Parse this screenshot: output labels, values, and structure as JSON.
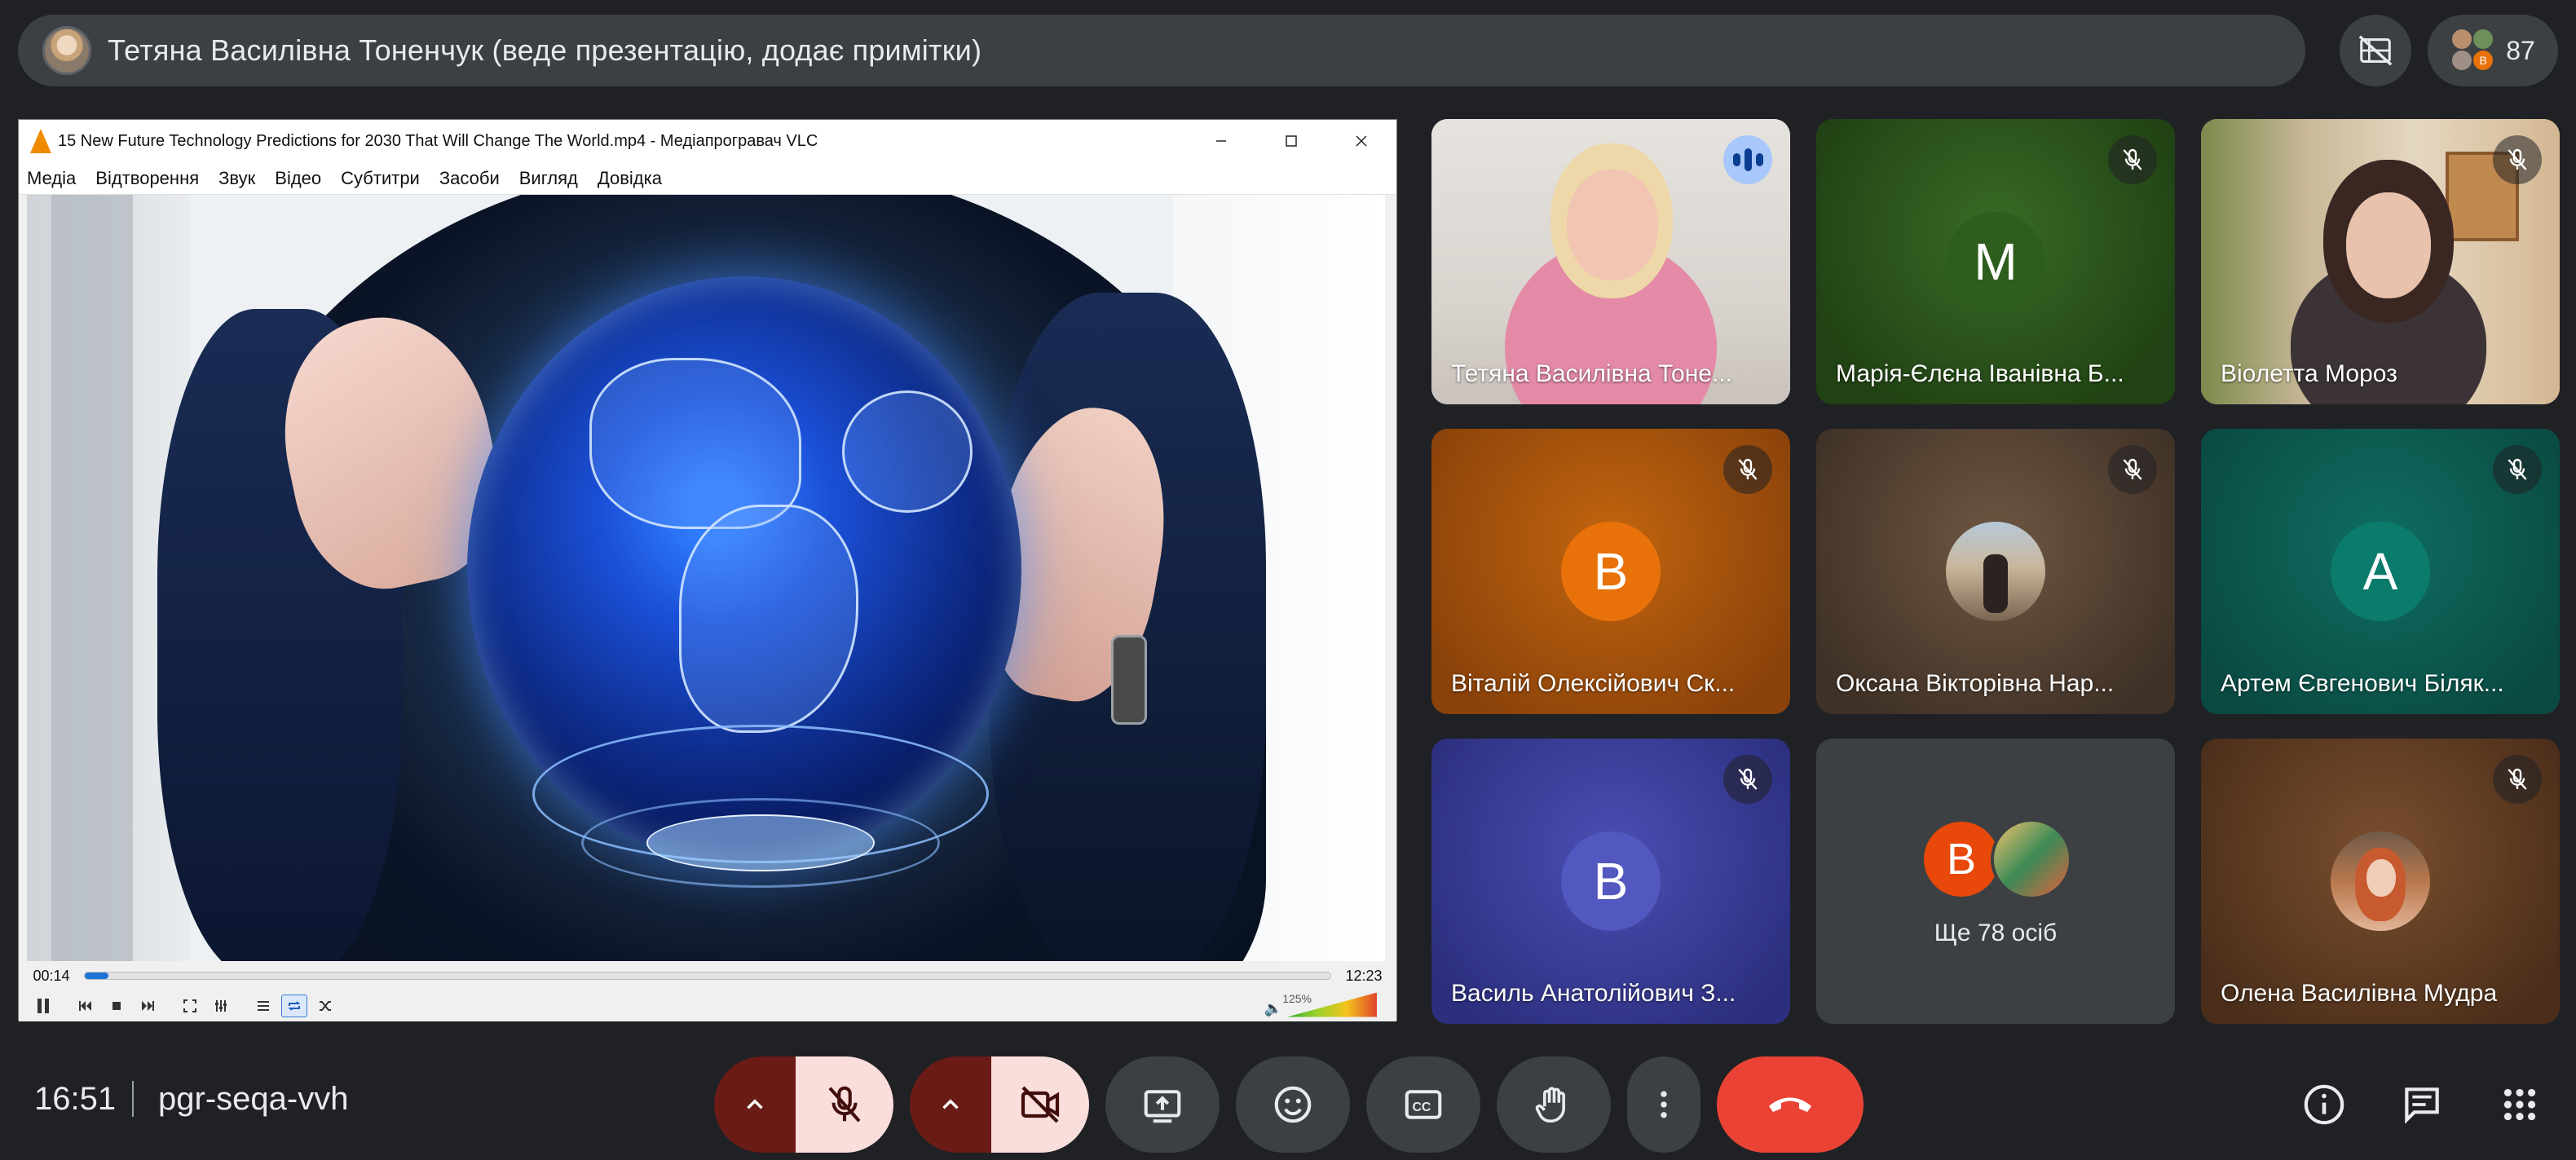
{
  "presenter": {
    "label": "Тетяна Василівна Тоненчук (веде презентацію, додає примітки)"
  },
  "top_right": {
    "participant_count": "87",
    "participant_badge": "В"
  },
  "vlc": {
    "title": "15 New Future Technology Predictions for 2030 That Will Change The World.mp4 - Медіапрогравач VLC",
    "menu": [
      "Медіа",
      "Відтворення",
      "Звук",
      "Відео",
      "Субтитри",
      "Засоби",
      "Вигляд",
      "Довідка"
    ],
    "elapsed": "00:14",
    "total": "12:23",
    "progress_fraction": 0.019,
    "volume": "125%"
  },
  "tiles": [
    {
      "name": "Тетяна Василівна Тоне...",
      "kind": "video",
      "speaking": true
    },
    {
      "name": "Марія-Єлєна Іванівна Б...",
      "kind": "letter",
      "letter": "М",
      "avatar_color": "#2e5e1e",
      "bg": "#23461a",
      "muted": true
    },
    {
      "name": "Віолетта Мороз",
      "kind": "video",
      "muted": true
    },
    {
      "name": "Віталій Олексійович Ск...",
      "kind": "letter",
      "letter": "В",
      "avatar_color": "#e8710a",
      "bg": "#b45309",
      "muted": true
    },
    {
      "name": "Оксана Вікторівна Нар...",
      "kind": "photo",
      "muted": true
    },
    {
      "name": "Артем Євгенович Біляк...",
      "kind": "letter",
      "letter": "А",
      "avatar_color": "#0b7b6b",
      "bg": "#0d5c52",
      "muted": true
    },
    {
      "name": "Василь Анатолійович З...",
      "kind": "letter",
      "letter": "В",
      "avatar_color": "#4b55b5",
      "bg": "#3b3f9c",
      "muted": true
    },
    {
      "name": "",
      "kind": "more",
      "more_label": "Ще 78 осіб",
      "more_letter": "В"
    },
    {
      "name": "Олена Василівна Мудра",
      "kind": "photo",
      "muted": true
    }
  ],
  "bottom": {
    "time": "16:51",
    "meeting_code": "pgr-seqa-vvh"
  },
  "colors": {
    "background": "#202124",
    "bar": "#3c4043",
    "end_call": "#ea4335",
    "muted_chip": "#f9dedc",
    "muted_chip_dark": "#6a1b16",
    "active_speaker": "#a8c7fa"
  },
  "icons": {
    "hide": "hide-tiles-icon",
    "mic": "mic-off-icon",
    "cam": "camera-off-icon",
    "present": "present-screen-icon",
    "emoji": "emoji-icon",
    "captions": "captions-icon",
    "hand": "raise-hand-icon",
    "more": "more-vert-icon",
    "end": "end-call-icon",
    "info": "info-icon",
    "chat": "chat-icon",
    "activities": "apps-grid-icon"
  }
}
